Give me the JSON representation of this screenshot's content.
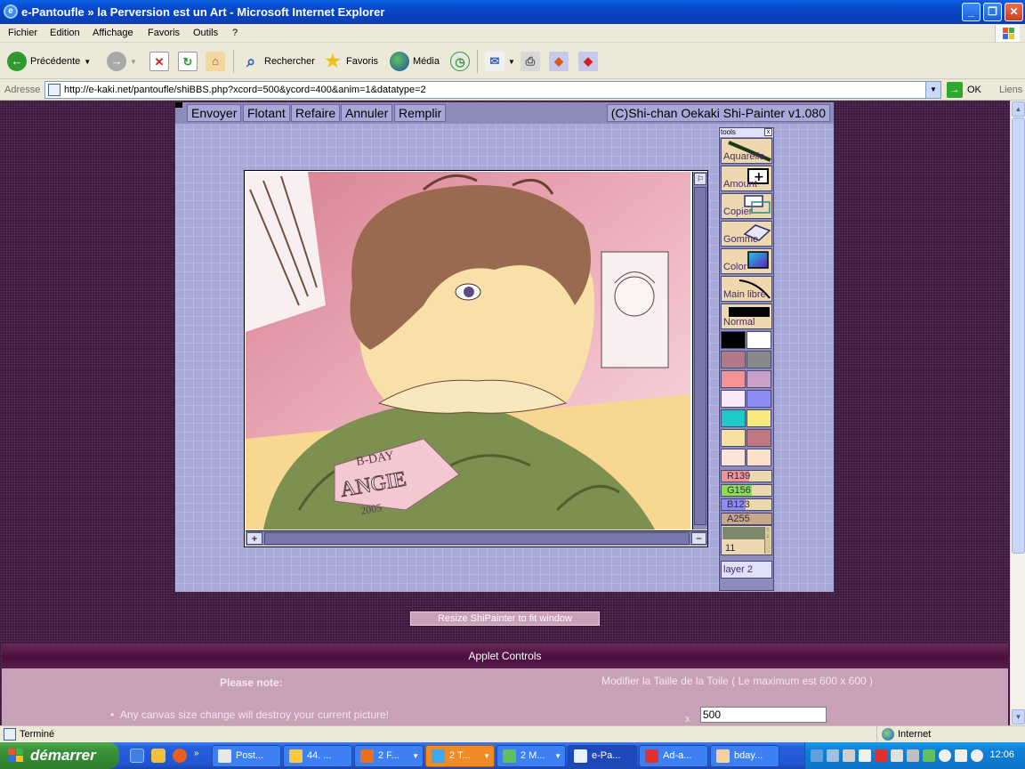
{
  "window": {
    "title": "e-Pantoufle » la Perversion est un Art - Microsoft Internet Explorer"
  },
  "menu": [
    "Fichier",
    "Edition",
    "Affichage",
    "Favoris",
    "Outils",
    "?"
  ],
  "toolbar": {
    "back": "Précédente",
    "search": "Rechercher",
    "favorites": "Favoris",
    "media": "Média"
  },
  "address": {
    "label": "Adresse",
    "url": "http://e-kaki.net/pantoufle/shiBBS.php?xcord=500&ycord=400&anim=1&datatype=2",
    "go": "OK",
    "links": "Liens"
  },
  "applet": {
    "buttons": [
      "Envoyer",
      "Flotant",
      "Refaire",
      "Annuler",
      "Remplir"
    ],
    "info": "(C)Shi-chan Oekaki Shi-Painter v1.080",
    "tools_title": "tools",
    "tools": [
      "Aquarelle",
      "Amount",
      "Copier",
      "Gomme",
      "Color",
      "Main libre",
      "Normal"
    ],
    "palette": [
      [
        "#000000",
        "#FFFFFF"
      ],
      [
        "#B07888",
        "#888888"
      ],
      [
        "#F49494",
        "#C8A0C8"
      ],
      [
        "#F8E8F8",
        "#8C8CF4"
      ],
      [
        "#20C8C8",
        "#F8E880"
      ],
      [
        "#F8E0A0",
        "#C07880"
      ],
      [
        "#FCE4DC",
        "#FCE0CC"
      ]
    ],
    "sliders": [
      {
        "label": "R139",
        "value": 139,
        "color": "#F49494"
      },
      {
        "label": "G156",
        "value": 156,
        "color": "#8CE04C"
      },
      {
        "label": "B123",
        "value": 123,
        "color": "#8C8CF4"
      },
      {
        "label": "A255",
        "value": 255,
        "color": "#C8A888"
      }
    ],
    "size": "11",
    "layer": "layer 2",
    "drawing_text": [
      "B-DAY",
      "ANGIE",
      "2005"
    ]
  },
  "page": {
    "resize_button": "Resize ShiPainter to fit window",
    "controls_title": "Applet Controls",
    "note_label": "Please note:",
    "canvas_size_label": "Modifier la Taille de la Toile ( Le maximum est 600 x 600 )",
    "bullet": "Any canvas size change will destroy your current picture!",
    "x_value": "500"
  },
  "status": {
    "text": "Terminé",
    "zone": "Internet"
  },
  "taskbar": {
    "start": "démarrer",
    "tasks": [
      {
        "label": "Post...",
        "color": "#E8E8E8",
        "arrow": false,
        "style": ""
      },
      {
        "label": "44. ...",
        "color": "#F8C840",
        "arrow": false,
        "style": ""
      },
      {
        "label": "2 F...",
        "color": "#E87020",
        "arrow": true,
        "style": ""
      },
      {
        "label": "2 T...",
        "color": "#40A8F0",
        "arrow": true,
        "style": "orange"
      },
      {
        "label": "2 M...",
        "color": "#60C060",
        "arrow": true,
        "style": ""
      },
      {
        "label": "e-Pa...",
        "color": "#E8F0FF",
        "arrow": false,
        "style": "active"
      },
      {
        "label": "Ad-a...",
        "color": "#E03030",
        "arrow": false,
        "style": ""
      },
      {
        "label": "bday...",
        "color": "#F8D0A0",
        "arrow": false,
        "style": ""
      }
    ],
    "clock": "12:06"
  }
}
